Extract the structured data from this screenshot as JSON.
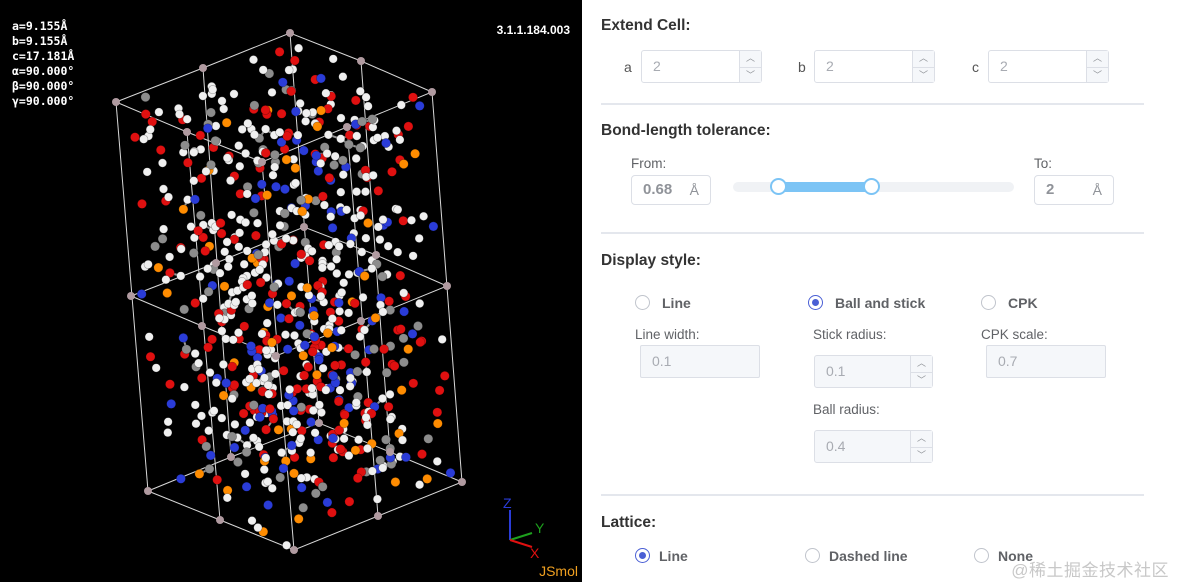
{
  "viewer": {
    "cell_params": [
      "a=9.155Å",
      "b=9.155Å",
      "c=17.181Å",
      "α=90.000°",
      "β=90.000°",
      "γ=90.000°"
    ],
    "version": "3.1.1.184.003",
    "logo": "JSmol",
    "axes": {
      "z": "Z",
      "y": "Y",
      "x": "X"
    },
    "atom_colors": {
      "hydrogen": "#f0f0f0",
      "oxygen": "#e01010",
      "nitrogen": "#2a3cd8",
      "phosphorus": "#ff8c00",
      "carbon": "#8c8c8c"
    },
    "axis_colors": {
      "z": "#2a3cd8",
      "y": "#1da01d",
      "x": "#e01010"
    }
  },
  "extend_cell": {
    "title": "Extend Cell:",
    "fields": [
      {
        "label": "a",
        "value": "2"
      },
      {
        "label": "b",
        "value": "2"
      },
      {
        "label": "c",
        "value": "2"
      }
    ]
  },
  "bond_tolerance": {
    "title": "Bond-length tolerance:",
    "from_label": "From:",
    "from_value": "0.68",
    "to_label": "To:",
    "to_value": "2",
    "unit": "Å"
  },
  "display_style": {
    "title": "Display style:",
    "options": [
      {
        "label": "Line",
        "checked": false
      },
      {
        "label": "Ball and stick",
        "checked": true
      },
      {
        "label": "CPK",
        "checked": false
      }
    ],
    "line_width_label": "Line width:",
    "line_width_value": "0.1",
    "stick_radius_label": "Stick radius:",
    "stick_radius_value": "0.1",
    "ball_radius_label": "Ball radius:",
    "ball_radius_value": "0.4",
    "cpk_scale_label": "CPK scale:",
    "cpk_scale_value": "0.7"
  },
  "lattice": {
    "title": "Lattice:",
    "options": [
      {
        "label": "Line",
        "checked": true
      },
      {
        "label": "Dashed line",
        "checked": false
      },
      {
        "label": "None",
        "checked": false
      }
    ]
  },
  "watermark": "@稀土掘金技术社区",
  "accent_color": "#4a5fd5"
}
